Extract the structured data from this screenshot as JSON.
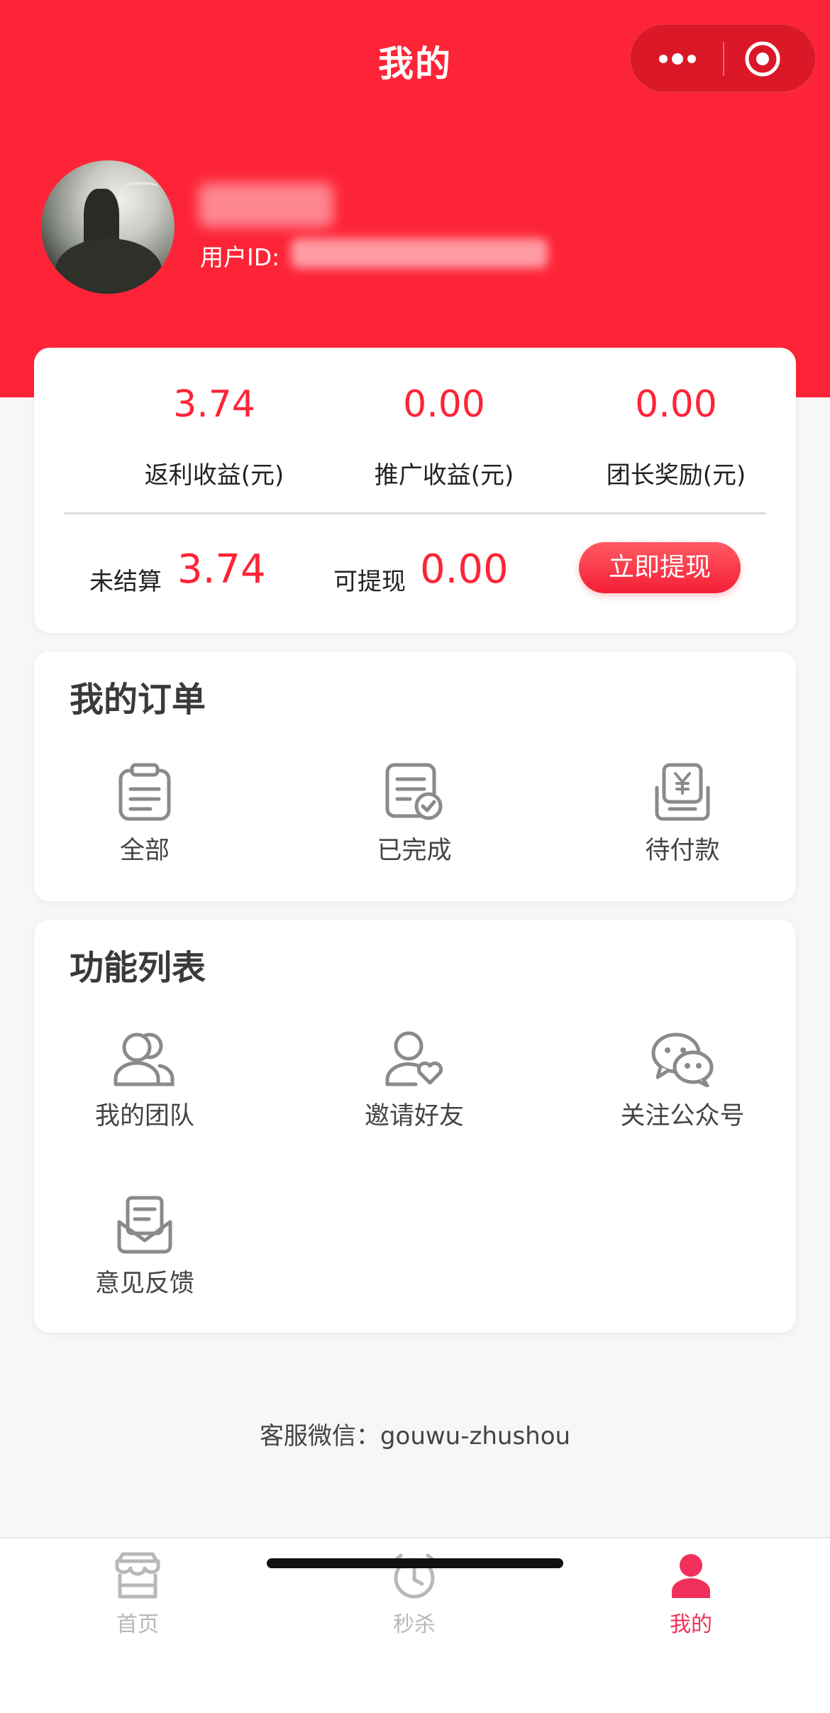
{
  "nav": {
    "title": "我的"
  },
  "user": {
    "id_label": "用户ID:"
  },
  "earnings": {
    "items": [
      {
        "value": "3.74",
        "label": "返利收益(元)"
      },
      {
        "value": "0.00",
        "label": "推广收益(元)"
      },
      {
        "value": "0.00",
        "label": "团长奖励(元)"
      }
    ],
    "unsettled_label": "未结算",
    "unsettled_value": "3.74",
    "withdrawable_label": "可提现",
    "withdrawable_value": "0.00",
    "withdraw_button": "立即提现"
  },
  "orders": {
    "title": "我的订单",
    "items": [
      {
        "label": "全部",
        "icon": "clipboard-icon"
      },
      {
        "label": "已完成",
        "icon": "document-check-icon"
      },
      {
        "label": "待付款",
        "icon": "payment-icon"
      }
    ]
  },
  "functions": {
    "title": "功能列表",
    "items": [
      {
        "label": "我的团队",
        "icon": "team-icon"
      },
      {
        "label": "邀请好友",
        "icon": "invite-icon"
      },
      {
        "label": "关注公众号",
        "icon": "wechat-icon"
      },
      {
        "label": "意见反馈",
        "icon": "feedback-icon"
      }
    ]
  },
  "service": {
    "text": "客服微信：gouwu-zhushou"
  },
  "tabbar": {
    "items": [
      {
        "label": "首页",
        "icon": "store-icon",
        "active": false
      },
      {
        "label": "秒杀",
        "icon": "alarm-clock-icon",
        "active": false
      },
      {
        "label": "我的",
        "icon": "user-icon",
        "active": true
      }
    ]
  },
  "colors": {
    "accent": "#fe2437",
    "tab_active": "#f0305a",
    "tab_inactive": "#b8b8b8",
    "icon_gray": "#8a8a8a"
  }
}
